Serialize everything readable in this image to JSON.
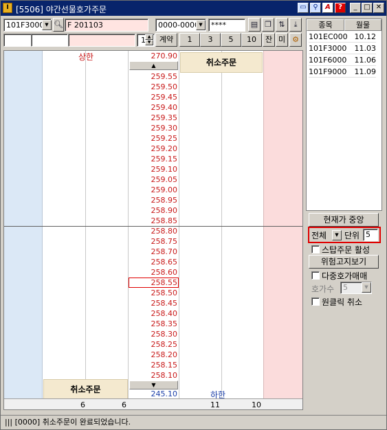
{
  "window": {
    "title": "[5506] 야간선물호가주문",
    "app_icon": "I"
  },
  "toolbar": {
    "code_value": "101F3000",
    "code_name": "F 201103",
    "account": "0000-0000",
    "password": "****",
    "qty_value": "1",
    "contract_label": "계약",
    "qty_presets": [
      "1",
      "3",
      "5",
      "10"
    ],
    "jan_label": "잔",
    "mi_label": "미"
  },
  "grid": {
    "upper_limit_label": "상한",
    "upper_limit_price": "270.90",
    "lower_limit_label": "하한",
    "lower_limit_price": "245.10",
    "cancel_order_label": "취소주문",
    "prices": [
      "259.55",
      "259.50",
      "259.45",
      "259.40",
      "259.35",
      "259.30",
      "259.25",
      "259.20",
      "259.15",
      "259.10",
      "259.05",
      "259.00",
      "258.95",
      "258.90",
      "258.85",
      "258.80",
      "258.75",
      "258.70",
      "258.65",
      "258.60",
      "258.55",
      "258.50",
      "258.45",
      "258.40",
      "258.35",
      "258.30",
      "258.25",
      "258.20",
      "258.15",
      "258.10"
    ],
    "current_price": "258.55",
    "totals": {
      "sell_count": "6",
      "sell_qty": "6",
      "buy_count": "11",
      "buy_qty": "10"
    }
  },
  "right_panel": {
    "table_headers": [
      "종목",
      "월물"
    ],
    "rows": [
      {
        "code": "101EC000",
        "month": "10.12"
      },
      {
        "code": "101F3000",
        "month": "11.03"
      },
      {
        "code": "101F6000",
        "month": "11.06"
      },
      {
        "code": "101F9000",
        "month": "11.09"
      }
    ],
    "center_button": "현재가 중앙",
    "scope_value": "전체",
    "unit_label": "단위",
    "unit_value": "5",
    "stop_order_label": "스탑주문 활성",
    "risk_button": "위험고지보기",
    "multi_quote_label": "다중호가매매",
    "quote_count_label": "호가수",
    "quote_count_value": "5",
    "one_click_label": "원클릭 취소"
  },
  "status": {
    "message": "||| [0000] 취소주문이 완료되었습니다."
  },
  "colors": {
    "ask_side": "#dbe8f6",
    "bid_side": "#fbdcdc",
    "price_red": "#c81818",
    "price_blue": "#1a3ea8",
    "highlight_border": "#e00000"
  }
}
